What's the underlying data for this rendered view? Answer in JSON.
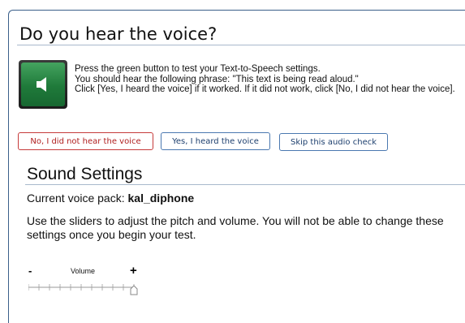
{
  "dialog": {
    "title": "Do you hear the voice?",
    "instructions": [
      "Press the green button to test your Text-to-Speech settings.",
      "You should hear the following phrase: \"This text is being read aloud.\"",
      "Click [Yes, I heard the voice] if it worked. If it did not work, click [No, I did not hear the voice]."
    ],
    "buttons": {
      "no_label": "No, I did not hear the voice",
      "yes_label": "Yes, I heard the voice",
      "skip_label": "Skip this audio check"
    },
    "speaker_icon": "speaker-icon"
  },
  "sound_settings": {
    "heading": "Sound Settings",
    "voice_pack_label": "Current voice pack:",
    "voice_pack_value": "kal_diphone",
    "description": "Use the sliders to adjust the pitch and volume. You will not be able to change these settings once you begin your test.",
    "volume": {
      "label": "Volume",
      "minus_symbol": "-",
      "plus_symbol": "+",
      "level": 1.0
    }
  },
  "colors": {
    "accent_border": "#3a5f8a",
    "no_button": "#c63a3a",
    "speaker_green": "#1f7a3a"
  }
}
